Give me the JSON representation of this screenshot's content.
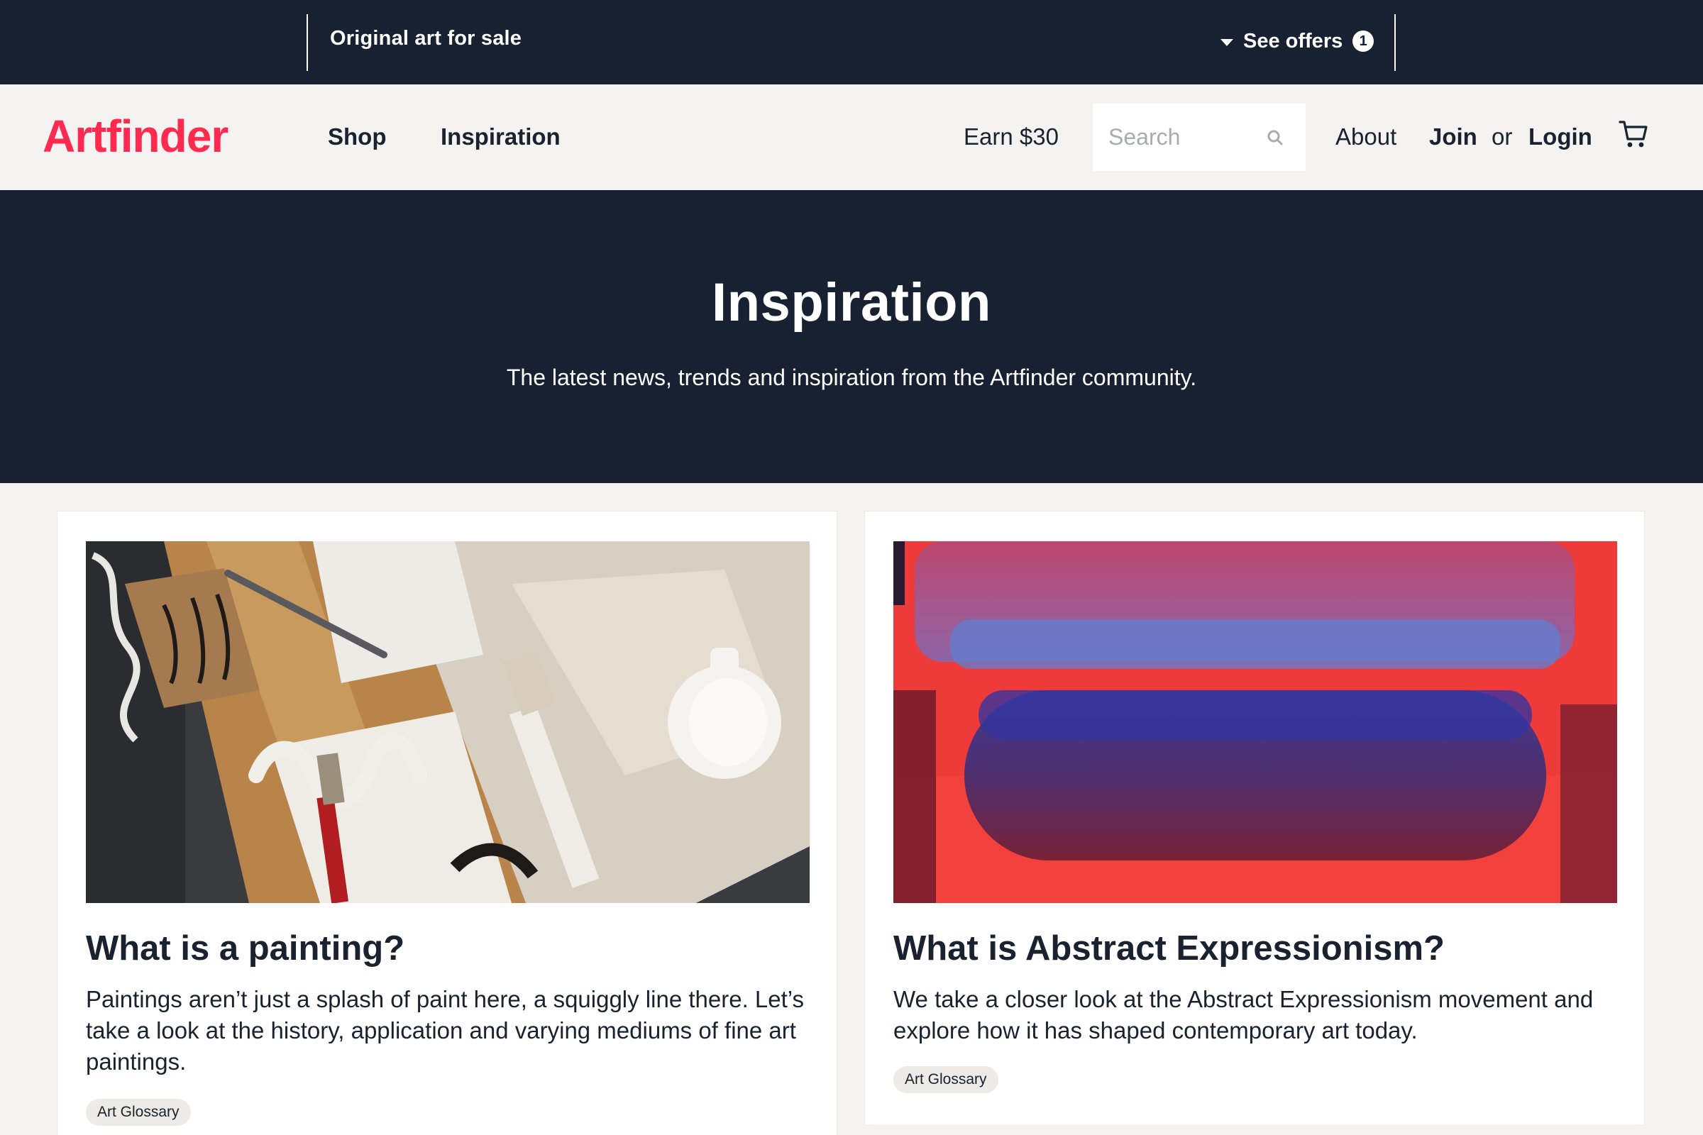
{
  "promo": {
    "title": "Original art for sale",
    "offers_label": "See offers",
    "offers_count": "1"
  },
  "header": {
    "logo": "Artfinder",
    "nav": [
      {
        "label": "Shop"
      },
      {
        "label": "Inspiration"
      }
    ],
    "earn_label": "Earn $30",
    "search": {
      "placeholder": "Search",
      "value": ""
    },
    "about_label": "About",
    "join_label": "Join",
    "or_label": "or",
    "login_label": "Login"
  },
  "hero": {
    "title": "Inspiration",
    "subtitle": "The latest news, trends and inspiration from the Artfinder community."
  },
  "articles": [
    {
      "title": "What is a painting?",
      "description": "Paintings aren’t just a splash of paint here, a squiggly line there. Let’s take a look at the history, application and varying mediums of fine art paintings.",
      "tag": "Art Glossary"
    },
    {
      "title": "What is Abstract Expressionism?",
      "description": "We take a closer look at the Abstract Expressionism movement and explore how it has shaped contemporary art today.",
      "tag": "Art Glossary"
    }
  ],
  "colors": {
    "navy": "#172131",
    "brand_red": "#ff2a50",
    "page_bg": "#f4f3f1",
    "text": "#1a2230"
  },
  "icons": [
    "caret-down-icon",
    "search-icon",
    "cart-icon"
  ]
}
